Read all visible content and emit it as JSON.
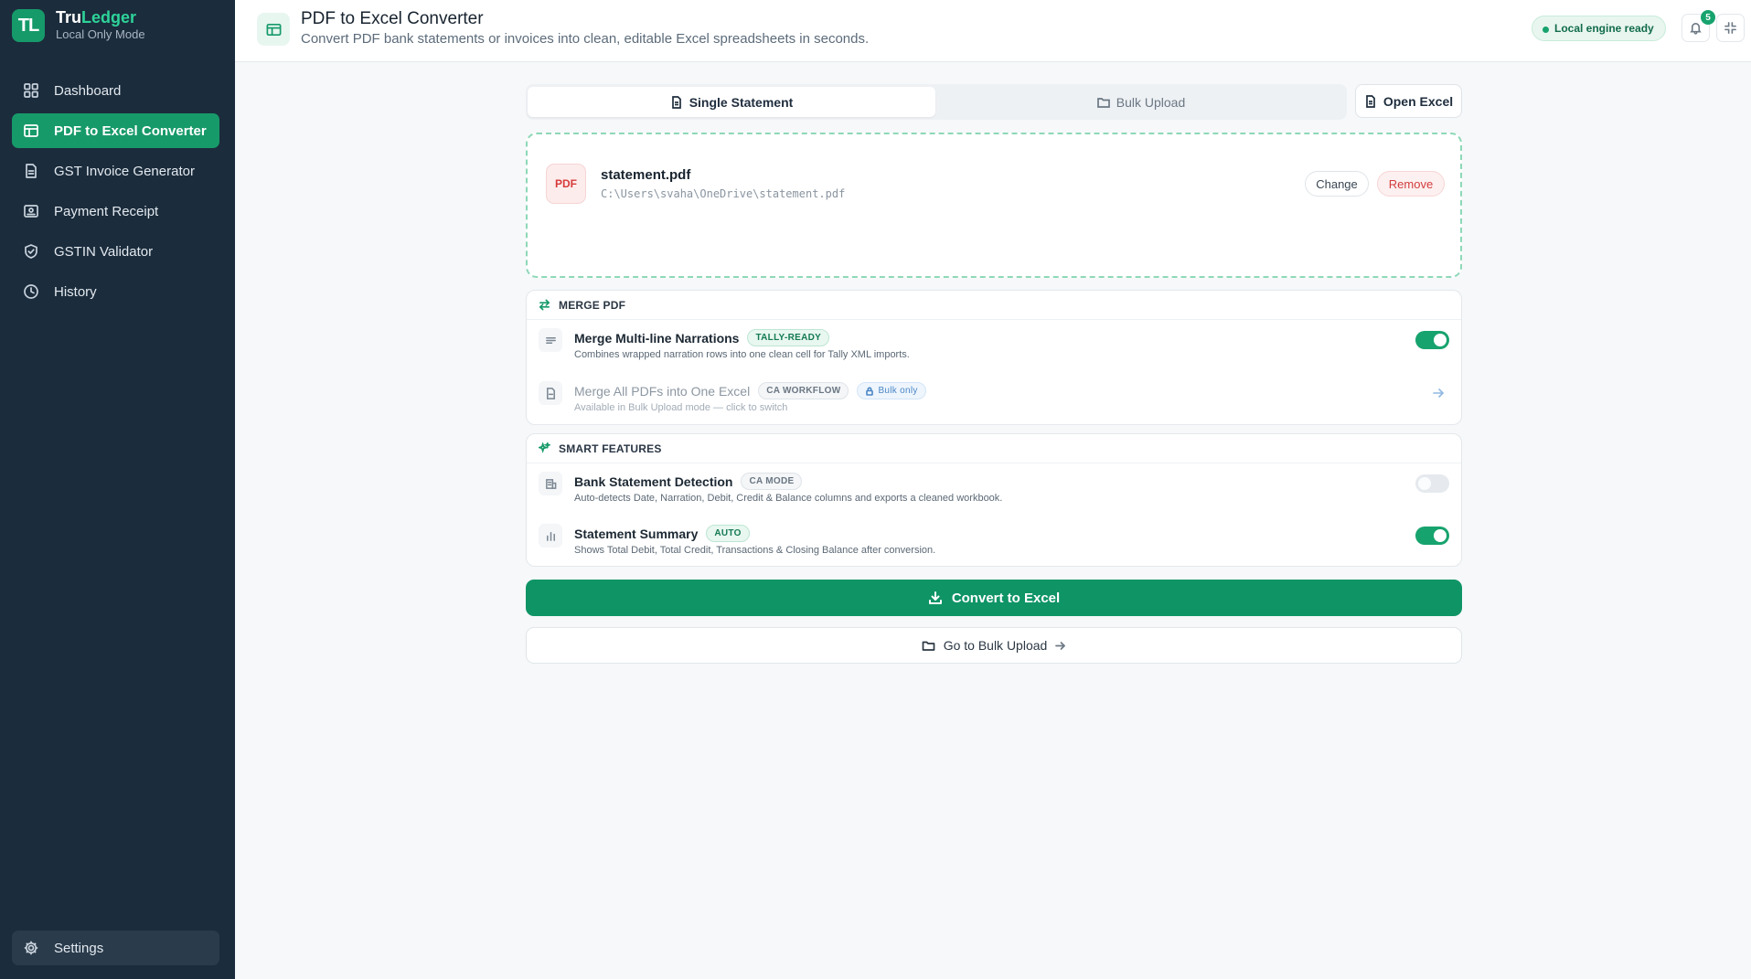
{
  "colors": {
    "sidebar_bg": "#1b2c3c",
    "accent": "#169a6a",
    "danger": "#d23c3c"
  },
  "brand": {
    "logo_text": "TL",
    "name_part1": "Tru",
    "name_part2": "Ledger",
    "subtitle": "Local Only Mode"
  },
  "sidebar": {
    "items": [
      {
        "label": "Dashboard",
        "icon": "grid-icon"
      },
      {
        "label": "PDF to Excel Converter",
        "icon": "table-icon",
        "active": true
      },
      {
        "label": "GST Invoice Generator",
        "icon": "document-icon"
      },
      {
        "label": "Payment Receipt",
        "icon": "receipt-icon"
      },
      {
        "label": "GSTIN Validator",
        "icon": "shield-check-icon"
      },
      {
        "label": "History",
        "icon": "clock-icon"
      }
    ],
    "settings_label": "Settings"
  },
  "header": {
    "title": "PDF to Excel Converter",
    "subtitle": "Convert PDF bank statements or invoices into clean, editable Excel spreadsheets in seconds.",
    "engine_status": "Local engine ready",
    "notification_count": "5"
  },
  "tabs": {
    "single": "Single Statement",
    "bulk": "Bulk Upload",
    "open_excel": "Open Excel"
  },
  "file": {
    "badge": "PDF",
    "name": "statement.pdf",
    "path": "C:\\Users\\svaha\\OneDrive\\statement.pdf",
    "change_label": "Change",
    "remove_label": "Remove"
  },
  "merge_section": {
    "title": "MERGE PDF",
    "options": [
      {
        "title": "Merge Multi-line Narrations",
        "tag": "TALLY-READY",
        "desc": "Combines wrapped narration rows into one clean cell for Tally XML imports.",
        "enabled": true
      },
      {
        "title": "Merge All PDFs into One Excel",
        "tag": "CA WORKFLOW",
        "tag2": "Bulk only",
        "desc": "Available in Bulk Upload mode — click to switch"
      }
    ]
  },
  "smart_section": {
    "title": "SMART FEATURES",
    "options": [
      {
        "title": "Bank Statement Detection",
        "tag": "CA MODE",
        "desc": "Auto-detects Date, Narration, Debit, Credit & Balance columns and exports a cleaned workbook.",
        "enabled": false
      },
      {
        "title": "Statement Summary",
        "tag": "AUTO",
        "desc": "Shows Total Debit, Total Credit, Transactions & Closing Balance after conversion.",
        "enabled": true
      }
    ]
  },
  "actions": {
    "convert": "Convert to Excel",
    "go_bulk": "Go to Bulk Upload"
  }
}
